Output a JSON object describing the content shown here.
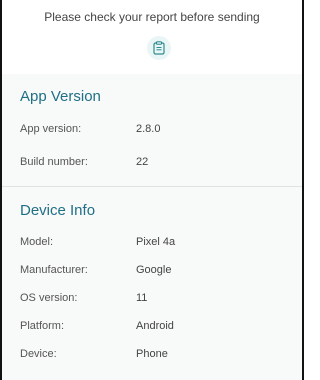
{
  "header": {
    "note": "Please check your report before sending",
    "icon": "clipboard-icon"
  },
  "app_version": {
    "title": "App Version",
    "rows": [
      {
        "label": "App version:",
        "value": "2.8.0"
      },
      {
        "label": "Build number:",
        "value": "22"
      }
    ]
  },
  "device_info": {
    "title": "Device Info",
    "rows": [
      {
        "label": "Model:",
        "value": "Pixel 4a"
      },
      {
        "label": "Manufacturer:",
        "value": "Google"
      },
      {
        "label": "OS version:",
        "value": "11"
      },
      {
        "label": "Platform:",
        "value": "Android"
      },
      {
        "label": "Device:",
        "value": "Phone"
      }
    ]
  },
  "colors": {
    "accent": "#1f6f86",
    "section_bg": "#f8f9f9",
    "icon_bg": "#eaf6f6"
  }
}
